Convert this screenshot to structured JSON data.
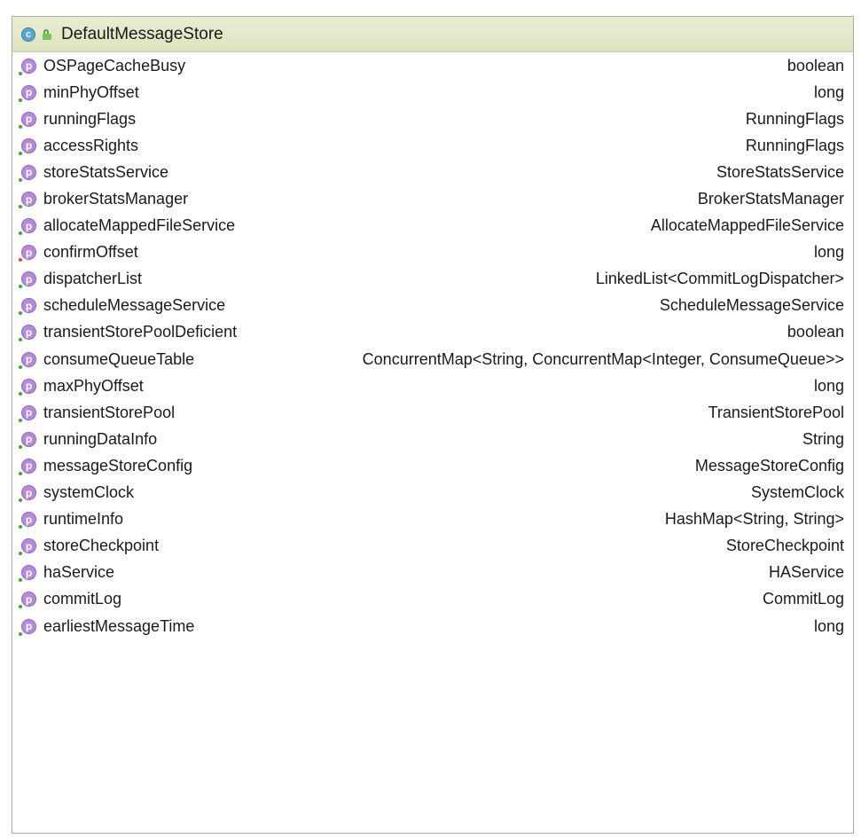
{
  "class": {
    "name": "DefaultMessageStore",
    "badge": "c",
    "icons": {
      "class": "class-icon",
      "visibility": "lock-icon",
      "property": "property-icon"
    },
    "colors": {
      "header_bg": "#e2e7c7",
      "class_badge": "#5aa8c9",
      "property_badge": "#b58ad6",
      "public_dot": "#44a336",
      "private_dot": "#e04a3a"
    }
  },
  "property_badge": "p",
  "properties": [
    {
      "name": "OSPageCacheBusy",
      "type": "boolean",
      "access": "public"
    },
    {
      "name": "minPhyOffset",
      "type": "long",
      "access": "public"
    },
    {
      "name": "runningFlags",
      "type": "RunningFlags",
      "access": "public"
    },
    {
      "name": "accessRights",
      "type": "RunningFlags",
      "access": "public"
    },
    {
      "name": "storeStatsService",
      "type": "StoreStatsService",
      "access": "public"
    },
    {
      "name": "brokerStatsManager",
      "type": "BrokerStatsManager",
      "access": "public"
    },
    {
      "name": "allocateMappedFileService",
      "type": "AllocateMappedFileService",
      "access": "public"
    },
    {
      "name": "confirmOffset",
      "type": "long",
      "access": "private"
    },
    {
      "name": "dispatcherList",
      "type": "LinkedList<CommitLogDispatcher>",
      "access": "public"
    },
    {
      "name": "scheduleMessageService",
      "type": "ScheduleMessageService",
      "access": "public"
    },
    {
      "name": "transientStorePoolDeficient",
      "type": "boolean",
      "access": "public"
    },
    {
      "name": "consumeQueueTable",
      "type": "ConcurrentMap<String, ConcurrentMap<Integer, ConsumeQueue>>",
      "access": "public"
    },
    {
      "name": "maxPhyOffset",
      "type": "long",
      "access": "public"
    },
    {
      "name": "transientStorePool",
      "type": "TransientStorePool",
      "access": "public"
    },
    {
      "name": "runningDataInfo",
      "type": "String",
      "access": "public"
    },
    {
      "name": "messageStoreConfig",
      "type": "MessageStoreConfig",
      "access": "public"
    },
    {
      "name": "systemClock",
      "type": "SystemClock",
      "access": "public"
    },
    {
      "name": "runtimeInfo",
      "type": "HashMap<String, String>",
      "access": "public"
    },
    {
      "name": "storeCheckpoint",
      "type": "StoreCheckpoint",
      "access": "public"
    },
    {
      "name": "haService",
      "type": "HAService",
      "access": "public"
    },
    {
      "name": "commitLog",
      "type": "CommitLog",
      "access": "public"
    },
    {
      "name": "earliestMessageTime",
      "type": "long",
      "access": "public"
    }
  ]
}
